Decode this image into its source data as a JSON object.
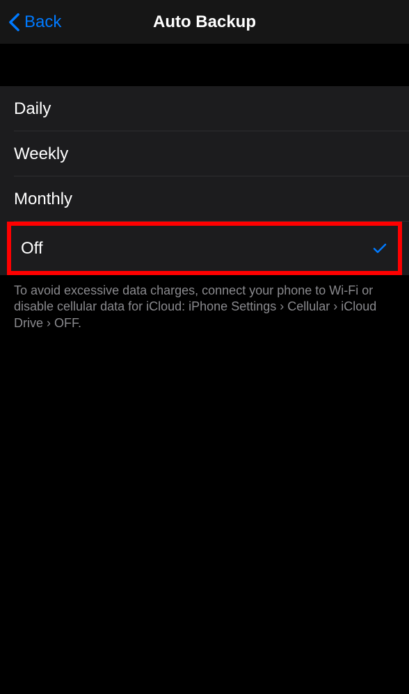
{
  "nav": {
    "back_label": "Back",
    "title": "Auto Backup"
  },
  "options": [
    {
      "label": "Daily",
      "selected": false
    },
    {
      "label": "Weekly",
      "selected": false
    },
    {
      "label": "Monthly",
      "selected": false
    },
    {
      "label": "Off",
      "selected": true,
      "highlighted": true
    }
  ],
  "footer_text": "To avoid excessive data charges, connect your phone to Wi-Fi or disable cellular data for iCloud: iPhone Settings › Cellular › iCloud Drive › OFF.",
  "colors": {
    "accent": "#007aff",
    "highlight_border": "#ff0000",
    "background": "#000000",
    "list_bg": "#1c1c1e"
  }
}
